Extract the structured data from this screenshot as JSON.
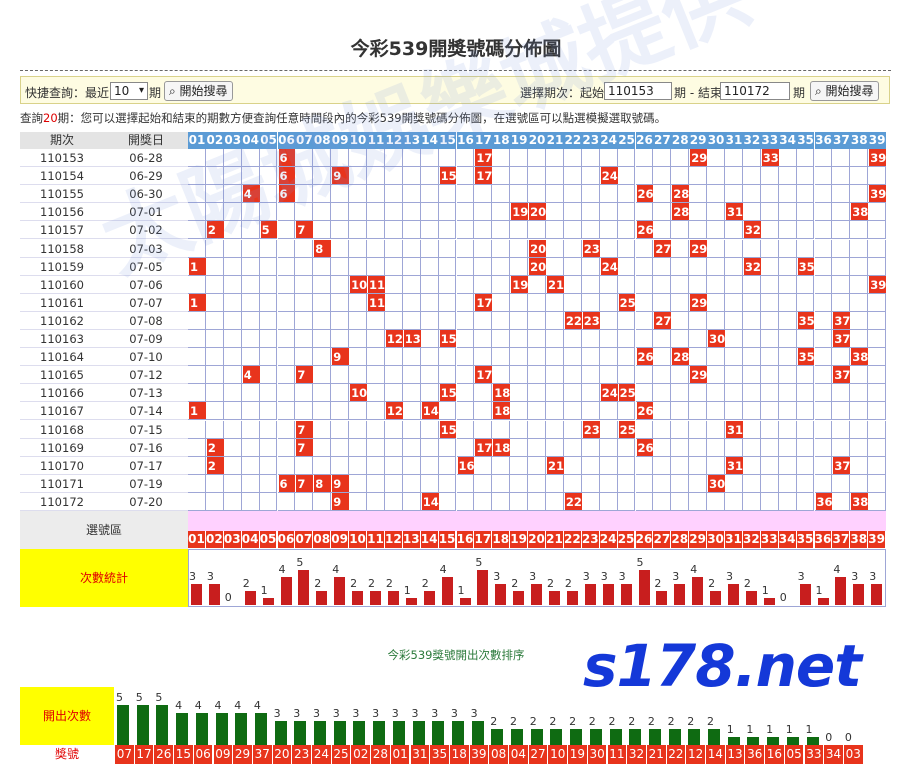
{
  "page_title": "今彩539開獎號碼分佈圖",
  "search": {
    "quick_label": "快捷查詢：最近",
    "recent_selected": "10",
    "period_unit": "期",
    "search_button": "開始搜尋",
    "range_label": "選擇期次：起始",
    "start_value": "110153",
    "mid_label": "期 - 結束",
    "end_value": "110172",
    "end_unit": "期",
    "search_button2": "開始搜尋"
  },
  "notice": {
    "prefix": "查詢",
    "count": "20",
    "suffix": "期：您可以選擇起始和結束的期數方便查詢任意時間段內的今彩539開獎號碼分佈圖，在選號區可以點選模擬選取號碼。"
  },
  "table": {
    "col_period": "期次",
    "col_date": "開獎日",
    "numbers": [
      "01",
      "02",
      "03",
      "04",
      "05",
      "06",
      "07",
      "08",
      "09",
      "10",
      "11",
      "12",
      "13",
      "14",
      "15",
      "16",
      "17",
      "18",
      "19",
      "20",
      "21",
      "22",
      "23",
      "24",
      "25",
      "26",
      "27",
      "28",
      "29",
      "30",
      "31",
      "32",
      "33",
      "34",
      "35",
      "36",
      "37",
      "38",
      "39"
    ],
    "rows": [
      {
        "period": "110153",
        "date": "06-28",
        "nums": [
          6,
          17,
          29,
          33,
          39
        ]
      },
      {
        "period": "110154",
        "date": "06-29",
        "nums": [
          6,
          9,
          15,
          17,
          24
        ]
      },
      {
        "period": "110155",
        "date": "06-30",
        "nums": [
          4,
          6,
          26,
          28,
          39
        ]
      },
      {
        "period": "110156",
        "date": "07-01",
        "nums": [
          19,
          20,
          28,
          31,
          38
        ]
      },
      {
        "period": "110157",
        "date": "07-02",
        "nums": [
          2,
          5,
          7,
          26,
          32
        ]
      },
      {
        "period": "110158",
        "date": "07-03",
        "nums": [
          8,
          20,
          23,
          27,
          29
        ]
      },
      {
        "period": "110159",
        "date": "07-05",
        "nums": [
          1,
          20,
          24,
          32,
          35
        ]
      },
      {
        "period": "110160",
        "date": "07-06",
        "nums": [
          10,
          11,
          19,
          21,
          39
        ]
      },
      {
        "period": "110161",
        "date": "07-07",
        "nums": [
          1,
          11,
          17,
          25,
          29
        ]
      },
      {
        "period": "110162",
        "date": "07-08",
        "nums": [
          22,
          23,
          27,
          35,
          37
        ]
      },
      {
        "period": "110163",
        "date": "07-09",
        "nums": [
          12,
          13,
          15,
          30,
          37
        ]
      },
      {
        "period": "110164",
        "date": "07-10",
        "nums": [
          9,
          26,
          28,
          35,
          38
        ]
      },
      {
        "period": "110165",
        "date": "07-12",
        "nums": [
          4,
          7,
          17,
          29,
          37
        ]
      },
      {
        "period": "110166",
        "date": "07-13",
        "nums": [
          10,
          15,
          18,
          24,
          25
        ]
      },
      {
        "period": "110167",
        "date": "07-14",
        "nums": [
          1,
          12,
          14,
          18,
          26
        ]
      },
      {
        "period": "110168",
        "date": "07-15",
        "nums": [
          7,
          15,
          23,
          25,
          31
        ]
      },
      {
        "period": "110169",
        "date": "07-16",
        "nums": [
          2,
          7,
          17,
          18,
          26
        ]
      },
      {
        "period": "110170",
        "date": "07-17",
        "nums": [
          2,
          16,
          21,
          31,
          37
        ]
      },
      {
        "period": "110171",
        "date": "07-19",
        "nums": [
          6,
          7,
          8,
          9,
          30
        ]
      },
      {
        "period": "110172",
        "date": "07-20",
        "nums": [
          9,
          14,
          22,
          36,
          38
        ]
      }
    ],
    "pick_label": "選號區",
    "count_label": "次數統計",
    "counts": [
      3,
      3,
      0,
      2,
      1,
      4,
      5,
      2,
      4,
      2,
      2,
      2,
      1,
      2,
      4,
      1,
      5,
      3,
      2,
      3,
      2,
      2,
      3,
      3,
      3,
      5,
      2,
      3,
      4,
      2,
      3,
      2,
      1,
      0,
      3,
      1,
      4,
      3,
      3
    ]
  },
  "ranking": {
    "title": "今彩539獎號開出次數排序",
    "count_label": "開出次數",
    "number_label": "獎號",
    "numbers": [
      "07",
      "17",
      "26",
      "15",
      "06",
      "09",
      "29",
      "37",
      "20",
      "23",
      "24",
      "25",
      "02",
      "28",
      "01",
      "31",
      "35",
      "18",
      "39",
      "08",
      "04",
      "27",
      "10",
      "19",
      "30",
      "11",
      "32",
      "21",
      "22",
      "12",
      "14",
      "13",
      "36",
      "16",
      "05",
      "33",
      "34",
      "03"
    ],
    "counts": [
      5,
      5,
      5,
      4,
      4,
      4,
      4,
      4,
      3,
      3,
      3,
      3,
      3,
      3,
      3,
      3,
      3,
      3,
      3,
      2,
      2,
      2,
      2,
      2,
      2,
      2,
      2,
      2,
      2,
      2,
      2,
      1,
      1,
      1,
      1,
      1,
      0,
      0
    ]
  },
  "watermark": {
    "logo": "s178.net",
    "slogan": "太陽城娛樂城提供"
  },
  "colors": {
    "hit": "#e8341c",
    "header": "#5b9bd5",
    "bar": "#c81e1e",
    "rank_bar": "#0f6b12",
    "highlight": "#ffff00"
  }
}
